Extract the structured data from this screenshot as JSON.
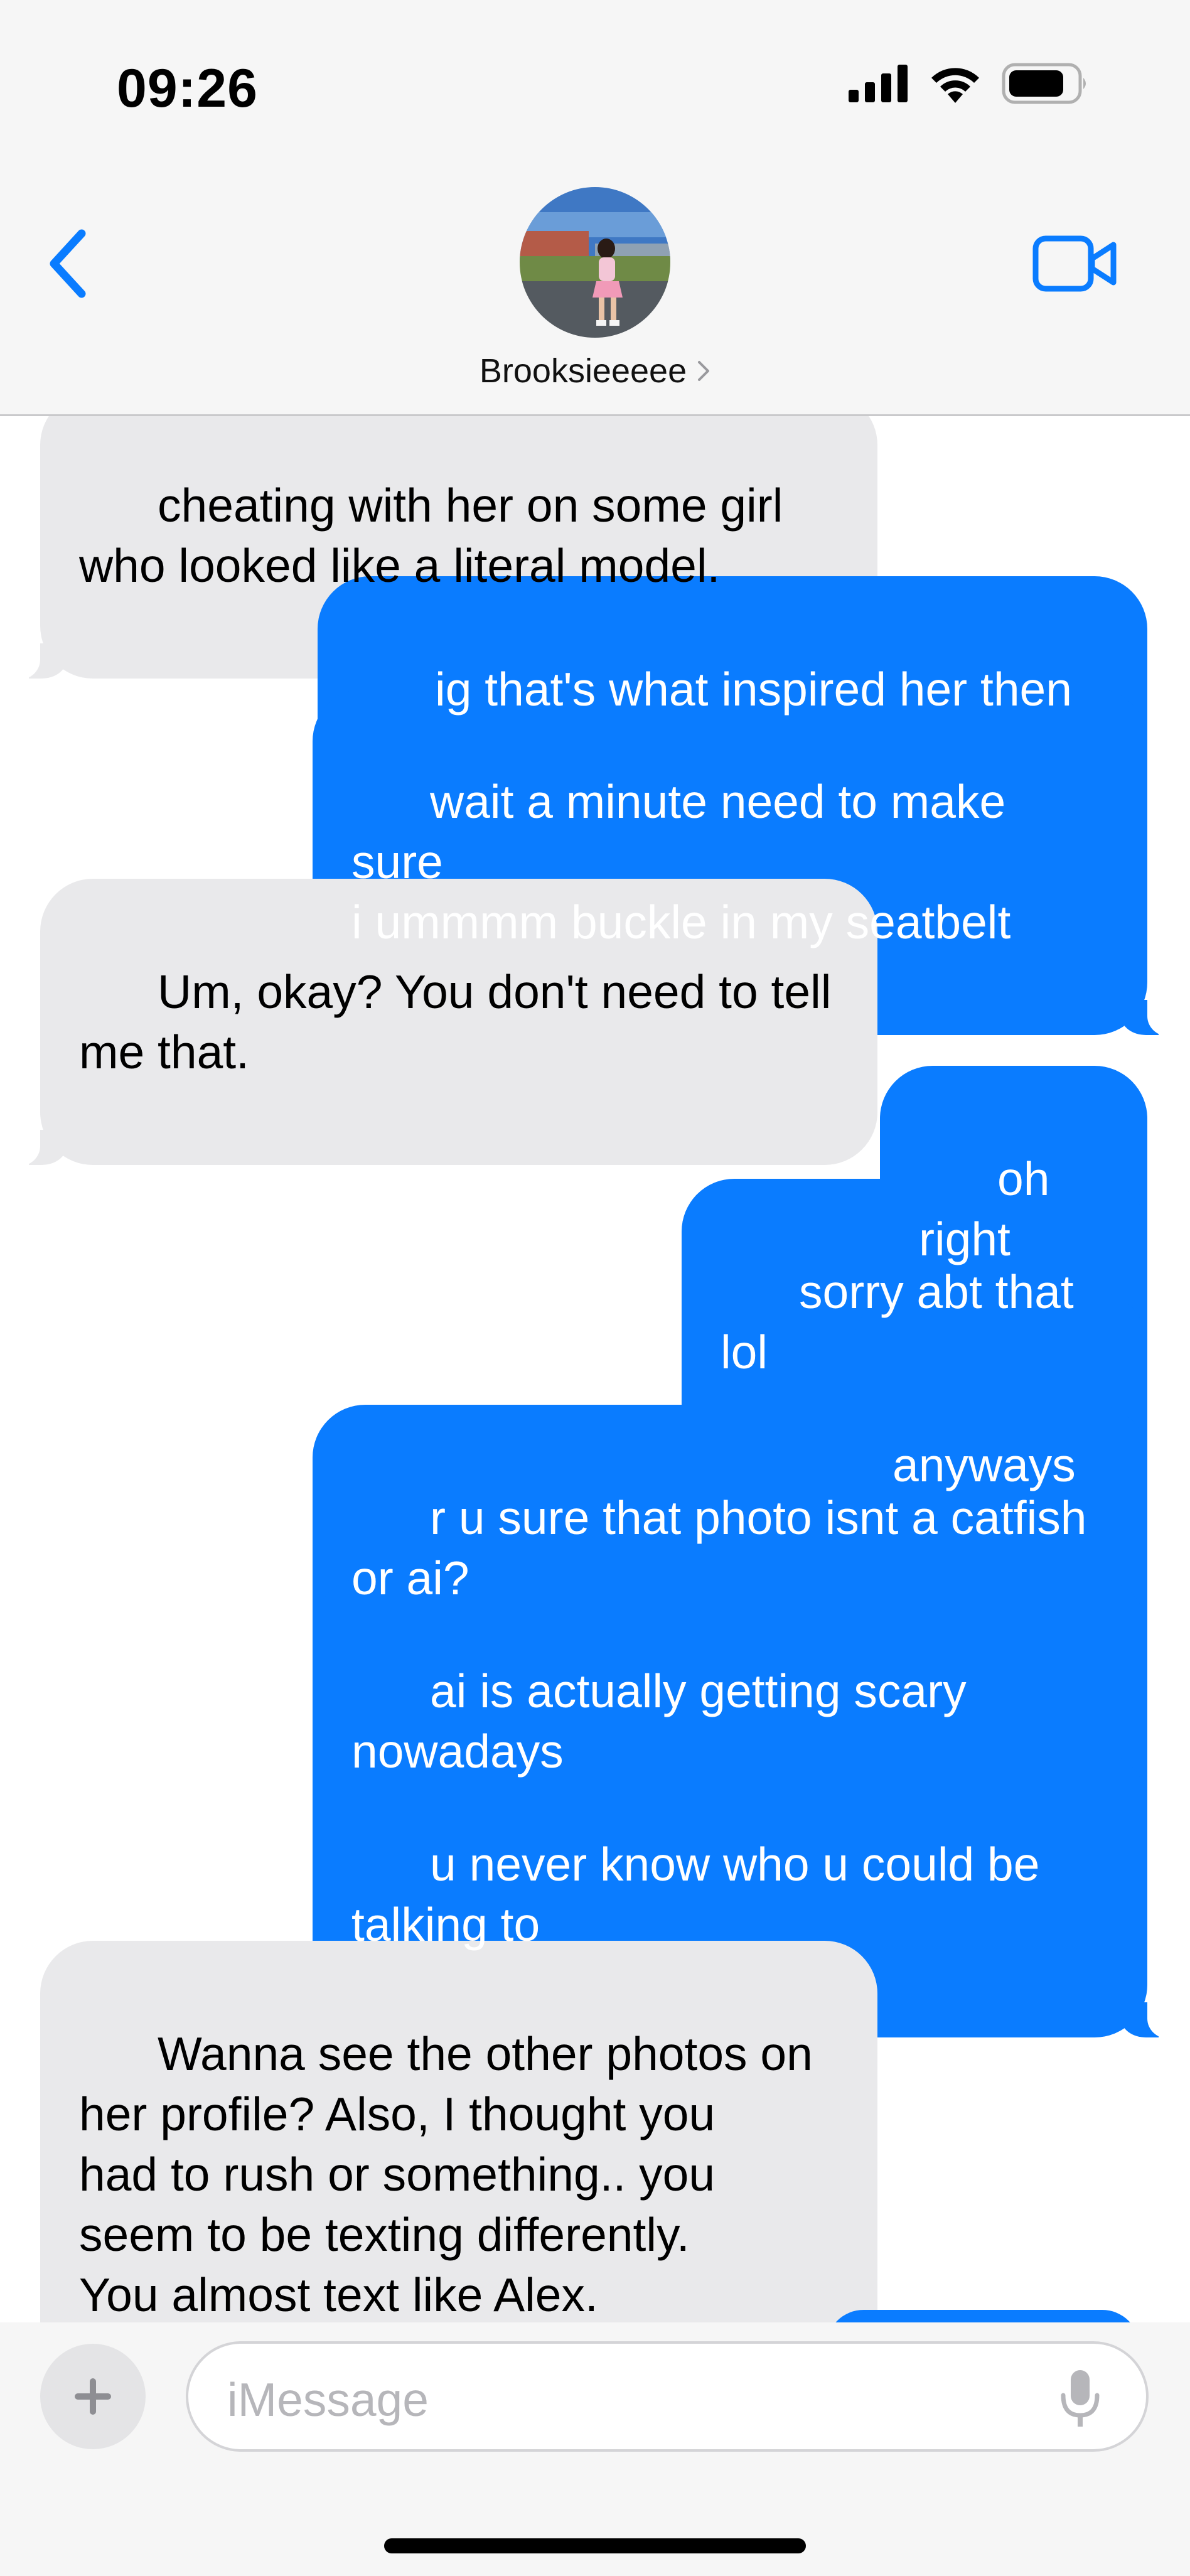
{
  "status_bar": {
    "time": "09:26",
    "icons": [
      "cellular-signal-icon",
      "wifi-icon",
      "battery-icon"
    ]
  },
  "header": {
    "contact_name": "Brooksieeeee",
    "back_icon": "chevron-left-icon",
    "video_icon": "video-camera-icon",
    "accent_color": "#0a7cff"
  },
  "messages": [
    {
      "from": "them",
      "text": "cheating with her on some girl\nwho looked like a literal model."
    },
    {
      "from": "me",
      "text": "ig that's what inspired her then"
    },
    {
      "from": "me",
      "text": "wait a minute need to make sure\ni ummmm buckle in my seatbelt"
    },
    {
      "from": "them",
      "text": "Um, okay? You don't need to tell\nme that."
    },
    {
      "from": "me",
      "text": "oh right"
    },
    {
      "from": "me",
      "text": "sorry abt that lol"
    },
    {
      "from": "me",
      "text": "anyways"
    },
    {
      "from": "me",
      "text": "r u sure that photo isnt a catfish\nor ai?"
    },
    {
      "from": "me",
      "text": "ai is actually getting scary\nnowadays"
    },
    {
      "from": "me",
      "text": "u never know who u could be\ntalking to"
    },
    {
      "from": "them",
      "text": "Wanna see the other photos on\nher profile? Also, I thought you\nhad to rush or something.. you\nseem to be texting differently.\nYou almost text like Alex."
    }
  ],
  "composer": {
    "placeholder": "iMessage",
    "plus_icon": "plus-icon",
    "mic_icon": "microphone-icon"
  },
  "colors": {
    "outgoing_bubble": "#0a7cff",
    "incoming_bubble": "#e9e9eb",
    "header_bg": "#f6f6f6"
  }
}
